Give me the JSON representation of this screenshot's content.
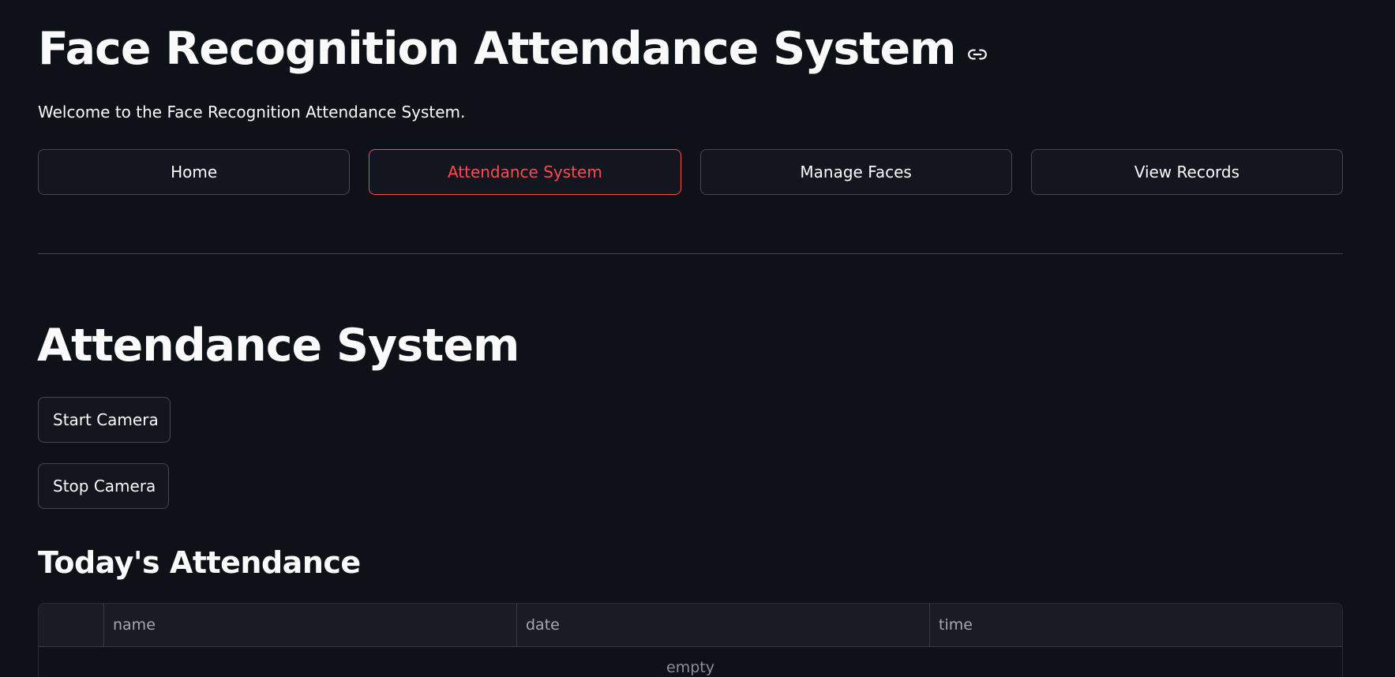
{
  "app": {
    "title": "Face Recognition Attendance System",
    "welcome": "Welcome to the Face Recognition Attendance System."
  },
  "icons": {
    "title_link": "link-icon"
  },
  "nav": {
    "items": [
      {
        "label": "Home",
        "active": false
      },
      {
        "label": "Attendance System",
        "active": true
      },
      {
        "label": "Manage Faces",
        "active": false
      },
      {
        "label": "View Records",
        "active": false
      }
    ]
  },
  "section": {
    "title": "Attendance System",
    "start_camera_label": "Start Camera",
    "stop_camera_label": "Stop Camera"
  },
  "attendance": {
    "title": "Today's Attendance",
    "columns": [
      "name",
      "date",
      "time"
    ],
    "rows": [],
    "empty_text": "empty"
  },
  "colors": {
    "background": "#0e1117",
    "accent": "#ff4b4b",
    "text": "#fafafa"
  }
}
